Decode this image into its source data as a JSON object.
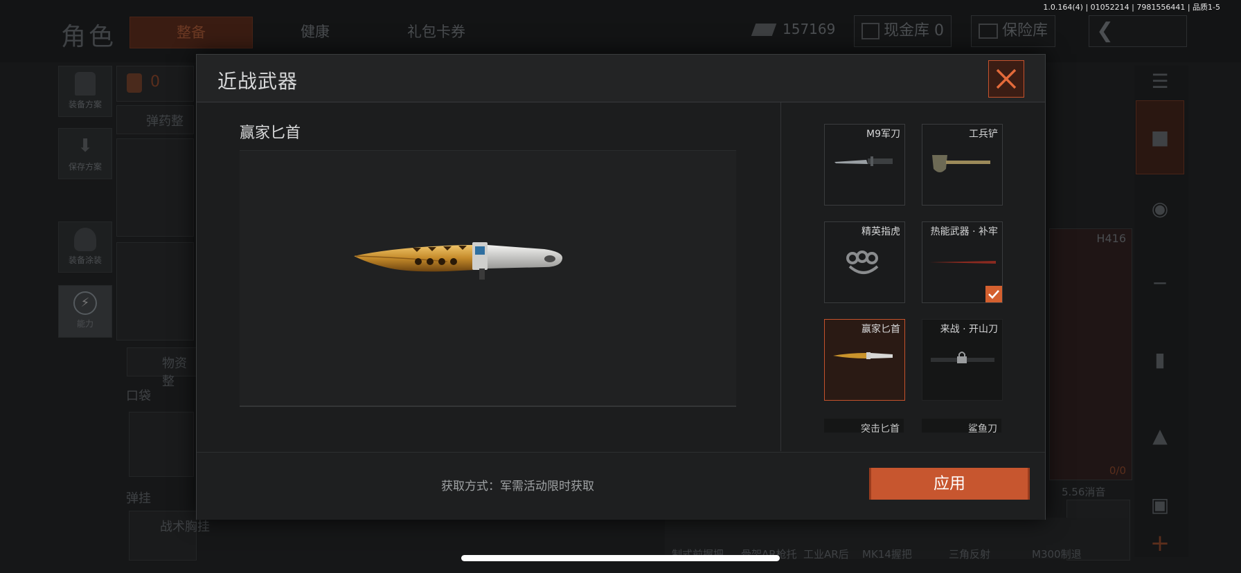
{
  "status": {
    "version": "1.0.164(4) | 01052214 | 7981556441 | 品质1-5"
  },
  "background": {
    "page_title": "角色",
    "tabs": [
      "整备",
      "健康",
      "礼包卡券"
    ],
    "currency": "157169",
    "cash_vault": "现金库 0",
    "insurance_vault": "保险库",
    "left_buttons": [
      "装备方案",
      "保存方案",
      "装备涂装",
      "能力"
    ],
    "backpack_count": "0",
    "ammo_label": "弹药整",
    "supply_label": "物资整",
    "pocket_label": "口袋",
    "chest_label": "弹挂",
    "chest_item": "战术胸挂",
    "weapon_name": "H416",
    "ammo_count": "0/0",
    "attachment": "5.56消音",
    "bottom_items": [
      "制式前握把",
      "骨架AR枪托",
      "工业AR后",
      "MK14握把",
      "三角反射",
      "M300制退"
    ]
  },
  "modal": {
    "title": "近战武器",
    "selected_name": "赢家匕首",
    "acquire_text": "获取方式：军需活动限时获取",
    "apply_label": "应用",
    "items": [
      {
        "label": "M9军刀",
        "state": "normal"
      },
      {
        "label": "工兵铲",
        "state": "normal"
      },
      {
        "label": "精英指虎",
        "state": "normal"
      },
      {
        "label": "热能武器 · 补牢",
        "state": "equipped"
      },
      {
        "label": "赢家匕首",
        "state": "selected"
      },
      {
        "label": "来战 · 开山刀",
        "state": "locked"
      },
      {
        "label": "突击匕首",
        "state": "partial"
      },
      {
        "label": "鲨鱼刀",
        "state": "partial"
      }
    ]
  },
  "colors": {
    "accent": "#c7562f",
    "panel": "#1c1d1e"
  }
}
